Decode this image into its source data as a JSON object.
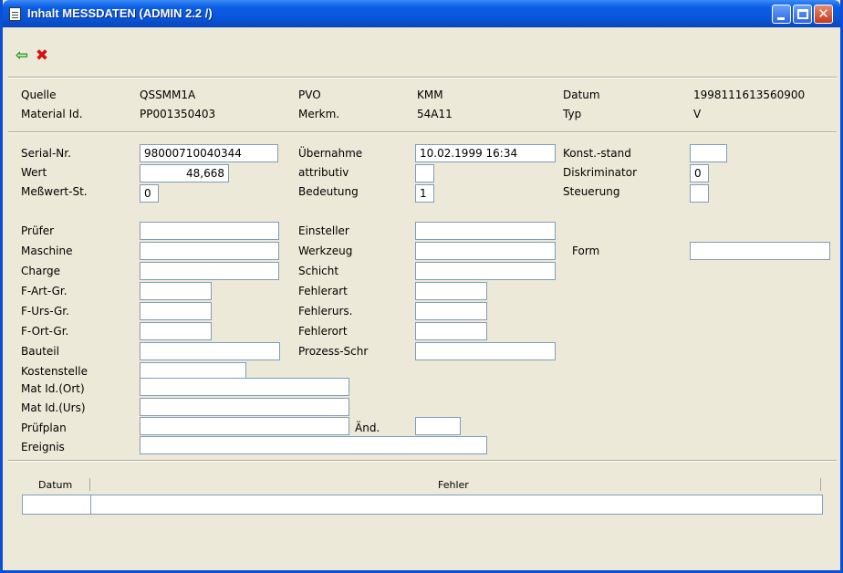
{
  "window": {
    "title": "Inhalt MESSDATEN (ADMIN 2.2 /)"
  },
  "toolbar": {
    "back_icon": "green-arrow-left-icon",
    "cancel_icon": "red-x-icon"
  },
  "header": {
    "quelle_label": "Quelle",
    "quelle_value": "QSSMM1A",
    "pvo_label": "PVO",
    "pvo_value": "KMM",
    "datum_label": "Datum",
    "datum_value": "1998111613560900",
    "material_label": "Material Id.",
    "material_value": "PP001350403",
    "merkm_label": "Merkm.",
    "merkm_value": "54A11",
    "typ_label": "Typ",
    "typ_value": "V"
  },
  "form": {
    "serial_label": "Serial-Nr.",
    "serial_value": "98000710040344",
    "uebernahme_label": "Übernahme",
    "uebernahme_value": "10.02.1999 16:34",
    "konst_label": "Konst.-stand",
    "konst_value": "",
    "wert_label": "Wert",
    "wert_value": "48,668",
    "attributiv_label": "attributiv",
    "attributiv_value": "",
    "diskriminator_label": "Diskriminator",
    "diskriminator_value": "0",
    "messwert_label": "Meßwert-St.",
    "messwert_value": "0",
    "bedeutung_label": "Bedeutung",
    "bedeutung_value": "1",
    "steuerung_label": "Steuerung",
    "steuerung_value": "",
    "pruefer_label": "Prüfer",
    "pruefer_value": "",
    "einsteller_label": "Einsteller",
    "einsteller_value": "",
    "maschine_label": "Maschine",
    "maschine_value": "",
    "werkzeug_label": "Werkzeug",
    "werkzeug_value": "",
    "form_label": "Form",
    "form_value": "",
    "charge_label": "Charge",
    "charge_value": "",
    "schicht_label": "Schicht",
    "schicht_value": "",
    "fartgr_label": "F-Art-Gr.",
    "fartgr_value": "",
    "fehlerart_label": "Fehlerart",
    "fehlerart_value": "",
    "fursgr_label": "F-Urs-Gr.",
    "fursgr_value": "",
    "fehlerurs_label": "Fehlerurs.",
    "fehlerurs_value": "",
    "fortgr_label": "F-Ort-Gr.",
    "fortgr_value": "",
    "fehlerort_label": "Fehlerort",
    "fehlerort_value": "",
    "bauteil_label": "Bauteil",
    "bauteil_value": "",
    "prozess_label": "Prozess-Schr",
    "prozess_value": "",
    "kostenstelle_label": "Kostenstelle",
    "kostenstelle_value": "",
    "matort_label": "Mat Id.(Ort)",
    "matort_value": "",
    "maturs_label": "Mat Id.(Urs)",
    "maturs_value": "",
    "pruefplan_label": "Prüfplan",
    "pruefplan_value": "",
    "aend_label": "Änd.",
    "aend_value": "",
    "ereignis_label": "Ereignis",
    "ereignis_value": ""
  },
  "grid": {
    "columns": [
      "Datum",
      "Fehler"
    ],
    "rows": [
      [
        "",
        ""
      ]
    ]
  }
}
